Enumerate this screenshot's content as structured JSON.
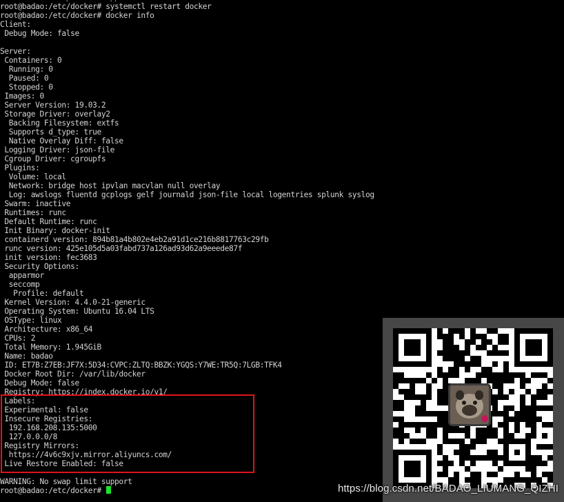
{
  "terminal": {
    "lines": [
      "WARNING: No swap limit support",
      "root@badao:/etc/docker# systemctl restart docker",
      "root@badao:/etc/docker# docker info",
      "Client:",
      " Debug Mode: false",
      "",
      "Server:",
      " Containers: 0",
      "  Running: 0",
      "  Paused: 0",
      "  Stopped: 0",
      " Images: 0",
      " Server Version: 19.03.2",
      " Storage Driver: overlay2",
      "  Backing Filesystem: extfs",
      "  Supports d_type: true",
      "  Native Overlay Diff: false",
      " Logging Driver: json-file",
      " Cgroup Driver: cgroupfs",
      " Plugins:",
      "  Volume: local",
      "  Network: bridge host ipvlan macvlan null overlay",
      "  Log: awslogs fluentd gcplogs gelf journald json-file local logentries splunk syslog",
      " Swarm: inactive",
      " Runtimes: runc",
      " Default Runtime: runc",
      " Init Binary: docker-init",
      " containerd version: 894b81a4b802e4eb2a91d1ce216b8817763c29fb",
      " runc version: 425e105d5a03fabd737a126ad93d62a9eeede87f",
      " init version: fec3683",
      " Security Options:",
      "  apparmor",
      "  seccomp",
      "   Profile: default",
      " Kernel Version: 4.4.0-21-generic",
      " Operating System: Ubuntu 16.04 LTS",
      " OSType: linux",
      " Architecture: x86_64",
      " CPUs: 2",
      " Total Memory: 1.945GiB",
      " Name: badao",
      " ID: ET7B:Z7EB:JF7X:5D34:CVPC:ZLTQ:BBZK:YGQS:Y7WE:TR5Q:7LGB:TFK4",
      " Docker Root Dir: /var/lib/docker",
      " Debug Mode: false",
      " Registry: https://index.docker.io/v1/",
      " Labels:",
      " Experimental: false",
      " Insecure Registries:",
      "  192.168.208.135:5000",
      "  127.0.0.0/8",
      " Registry Mirrors:",
      "  https://4v6c9xjv.mirror.aliyuncs.com/",
      " Live Restore Enabled: false",
      "",
      "WARNING: No swap limit support",
      "root@badao:/etc/docker# "
    ]
  },
  "watermark": "https://blog.csdn.net/BADAO_LIUMANG_QIZHI",
  "colors": {
    "background": "#000000",
    "text": "#d4d4d4",
    "cursor": "#19e62a",
    "highlight_box": "#e0141c",
    "qr_panel": "#474747"
  },
  "icons": [
    "qr-code-icon",
    "avatar-icon"
  ]
}
